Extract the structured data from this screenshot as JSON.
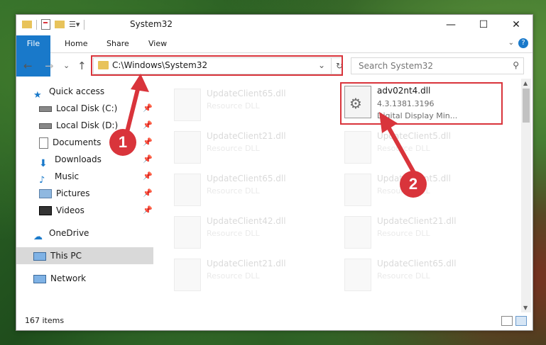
{
  "window": {
    "title": "System32",
    "controls": {
      "minimize": "—",
      "maximize": "☐",
      "close": "✕"
    }
  },
  "ribbon": {
    "tabs": [
      "File",
      "Home",
      "Share",
      "View"
    ],
    "expand": "⌄",
    "help": "?"
  },
  "nav": {
    "back": "←",
    "forward": "→",
    "recent": "⌄",
    "up": "↑"
  },
  "address": {
    "path": "C:\\Windows\\System32",
    "dropdown": "⌄",
    "refresh": "↻"
  },
  "search": {
    "placeholder": "Search System32"
  },
  "sidebar": {
    "items": [
      {
        "label": "Quick access",
        "icon": "star-icon"
      },
      {
        "label": "Local Disk (C:)",
        "icon": "drive-icon",
        "pinned": true
      },
      {
        "label": "Local Disk (D:)",
        "icon": "drive-icon",
        "pinned": true
      },
      {
        "label": "Documents",
        "icon": "documents-icon",
        "pinned": true
      },
      {
        "label": "Downloads",
        "icon": "download-icon",
        "pinned": true
      },
      {
        "label": "Music",
        "icon": "music-icon",
        "pinned": true
      },
      {
        "label": "Pictures",
        "icon": "pictures-icon",
        "pinned": true
      },
      {
        "label": "Videos",
        "icon": "videos-icon",
        "pinned": true
      },
      {
        "label": "OneDrive",
        "icon": "cloud-icon"
      },
      {
        "label": "This PC",
        "icon": "computer-icon",
        "selected": true
      },
      {
        "label": "Network",
        "icon": "network-icon"
      }
    ]
  },
  "files": {
    "target": {
      "name": "adv02nt4.dll",
      "version": "4.3.1381.3196",
      "description": "Digital Display Min..."
    },
    "faded": [
      {
        "name": "UpdateClient65.dll",
        "type": "Resource DLL"
      },
      {
        "name": "UpdateClient21.dll",
        "type": "Resource DLL"
      },
      {
        "name": "UpdateClient5.dll",
        "type": "Resource DLL"
      },
      {
        "name": "UpdateClient65.dll",
        "type": "Resource DLL"
      },
      {
        "name": "UpdateClient5.dll",
        "type": "Resource DLL"
      },
      {
        "name": "UpdateClient42.dll",
        "type": "Resource DLL"
      },
      {
        "name": "UpdateClient21.dll",
        "type": "Resource DLL"
      },
      {
        "name": "UpdateClient21.dll",
        "type": "Resource DLL"
      },
      {
        "name": "UpdateClient65.dll",
        "type": "Resource DLL"
      }
    ]
  },
  "status": {
    "count": "167 items"
  },
  "annotations": {
    "step1": "1",
    "step2": "2"
  },
  "colors": {
    "accent": "#1979ca",
    "annotation": "#d9343b"
  }
}
